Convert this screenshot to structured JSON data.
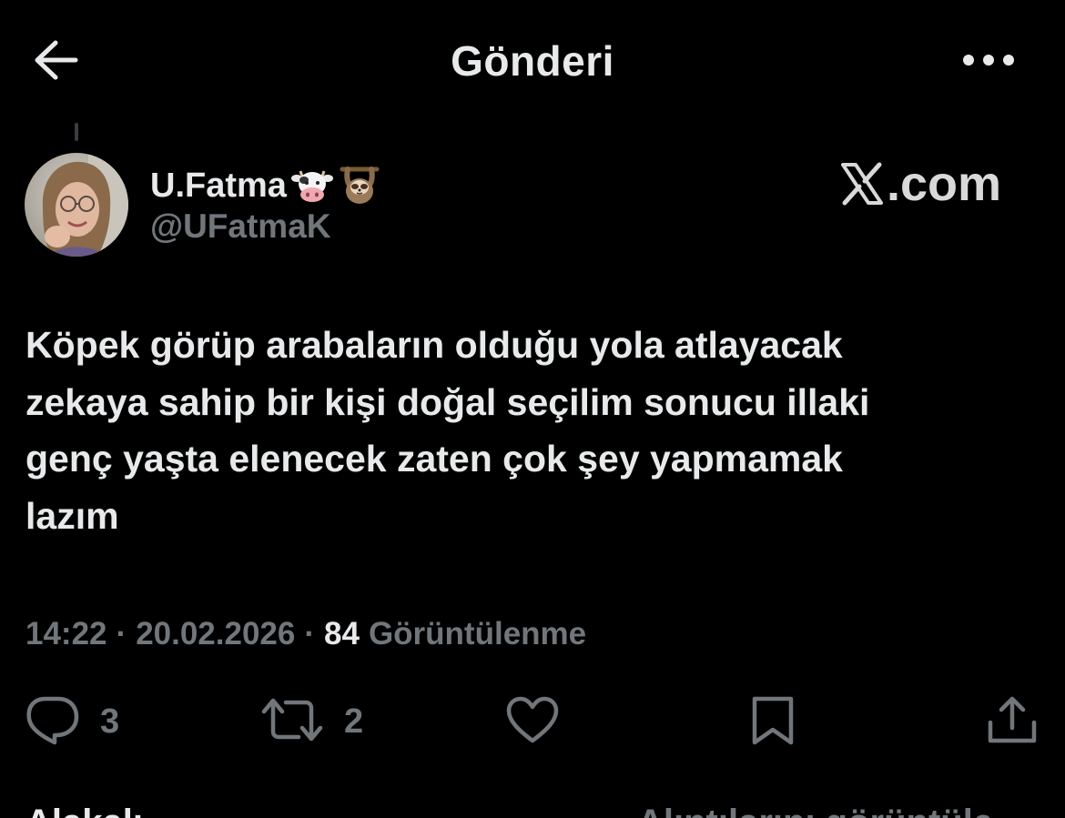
{
  "header": {
    "title": "Gönderi",
    "back_icon": "arrow-left-icon",
    "more_icon": "more-horizontal-icon"
  },
  "author": {
    "name": "U.Fatma",
    "name_emojis": [
      "cow-face-icon",
      "sloth-icon"
    ],
    "handle": "@UFatmaK"
  },
  "watermark": {
    "logo_icon": "x-logo-icon",
    "suffix": ".com"
  },
  "tweet": {
    "lines": [
      "Köpek görüp arabaların olduğu yola atlayacak",
      "zekaya sahip bir kişi doğal seçilim sonucu illaki",
      "genç yaşta elenecek zaten çok şey yapmamak",
      "lazım"
    ]
  },
  "meta": {
    "time": "14:22",
    "date": "20.02.2026",
    "views_count": "84",
    "views_label": "Görüntülenme"
  },
  "actions": {
    "reply_count": "3",
    "retweet_count": "2"
  },
  "bottom": {
    "left_text": "Alakalı",
    "right_text": "Alıntılarını görüntüle"
  },
  "colors": {
    "background": "#000000",
    "text_primary": "#e7e9ea",
    "text_secondary": "#71767b"
  }
}
